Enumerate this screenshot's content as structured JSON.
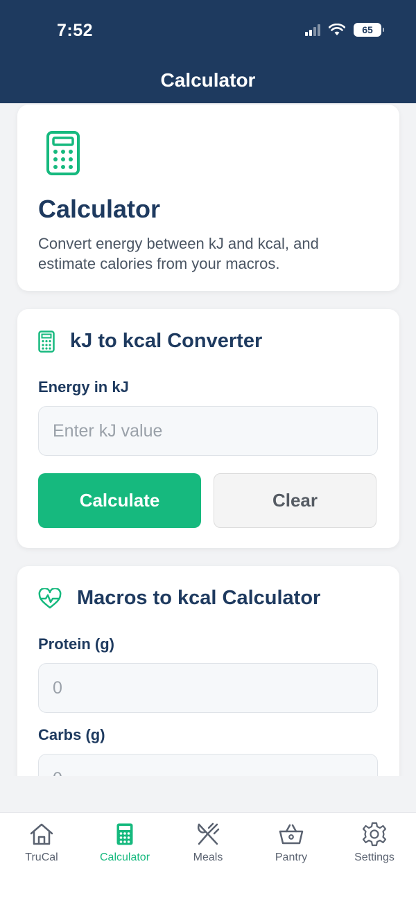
{
  "status_bar": {
    "time": "7:52",
    "battery": "65"
  },
  "nav": {
    "title": "Calculator"
  },
  "intro": {
    "title": "Calculator",
    "description": "Convert energy between kJ and kcal, and estimate calories from your macros."
  },
  "converter": {
    "title": "kJ to kcal Converter",
    "energy_label": "Energy in kJ",
    "energy_placeholder": "Enter kJ value",
    "calculate_label": "Calculate",
    "clear_label": "Clear"
  },
  "macros": {
    "title": "Macros to kcal Calculator",
    "protein_label": "Protein (g)",
    "protein_placeholder": "0",
    "carbs_label": "Carbs (g)",
    "carbs_placeholder": "0"
  },
  "tabs": [
    {
      "label": "TruCal",
      "icon": "home-icon"
    },
    {
      "label": "Calculator",
      "icon": "calculator-icon",
      "active": true
    },
    {
      "label": "Meals",
      "icon": "utensils-icon"
    },
    {
      "label": "Pantry",
      "icon": "basket-icon"
    },
    {
      "label": "Settings",
      "icon": "gear-icon"
    }
  ],
  "colors": {
    "primary": "#1e3a5f",
    "accent": "#16b97e",
    "background": "#f2f3f5"
  }
}
